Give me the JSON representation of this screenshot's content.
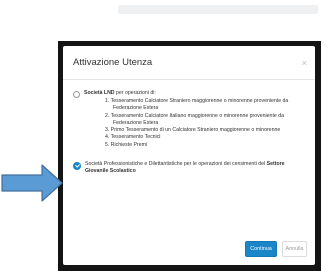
{
  "modal": {
    "title": "Attivazione Utenza",
    "close": "×",
    "option1": {
      "bold": "Società LND",
      "text": " per operazioni di:",
      "items": [
        "1. Tesseramento Calciatore Straniero maggiorenne o minorenne proveniente da",
        "Federazione Estera",
        "2. Tesseramento Calciatore Italiano maggiorenne o minorenne proveniente da",
        "Federazione Estera",
        "3. Primo Tesseramento di un Calciatore Straniero maggiorenne o minorenne",
        "4. Tesseramento Tecnici",
        "5. Richieste Premi"
      ]
    },
    "option2": {
      "text": "Società Professionistiche e Dilettantistiche per le operazioni dei censimenti del ",
      "bold": "Settore Giovanile Scolastico"
    },
    "buttons": {
      "confirm": "Continua",
      "cancel": "Annulla"
    }
  },
  "colors": {
    "accent": "#1a86c7",
    "arrow": "#5b9bd5",
    "arrow_border": "#41719c"
  },
  "icons": {
    "pointer": "arrow-right-icon",
    "radio_on": "radio-checked-icon"
  }
}
